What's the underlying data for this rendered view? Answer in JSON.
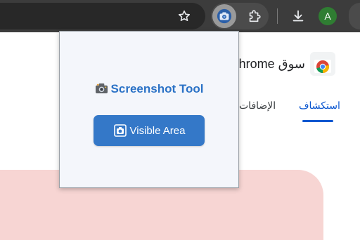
{
  "popup": {
    "title": "Screenshot Tool",
    "button_label": "Visible Area"
  },
  "store": {
    "title": "سوق chrome",
    "tabs": [
      {
        "label": "استكشاف",
        "active": true
      },
      {
        "label": "الإضافات",
        "active": false
      }
    ]
  },
  "toolbar": {
    "avatar_letter": "A"
  },
  "icons": {
    "bookmark": "star-icon",
    "extension_active": "camera-extension-icon",
    "extensions_menu": "puzzle-icon",
    "downloads": "download-icon",
    "popup_title": "camera-icon",
    "popup_button": "camera-frame-icon",
    "store_logo": "chrome-logo-icon"
  },
  "colors": {
    "toolbar_bg": "#3c3c3c",
    "popup_bg": "#f4f6fb",
    "accent_blue": "#2b72c6",
    "button_blue": "#3478c8",
    "tab_active": "#0b57d0",
    "banner_pink": "#f7d5d3",
    "avatar_green": "#2f7d32"
  }
}
